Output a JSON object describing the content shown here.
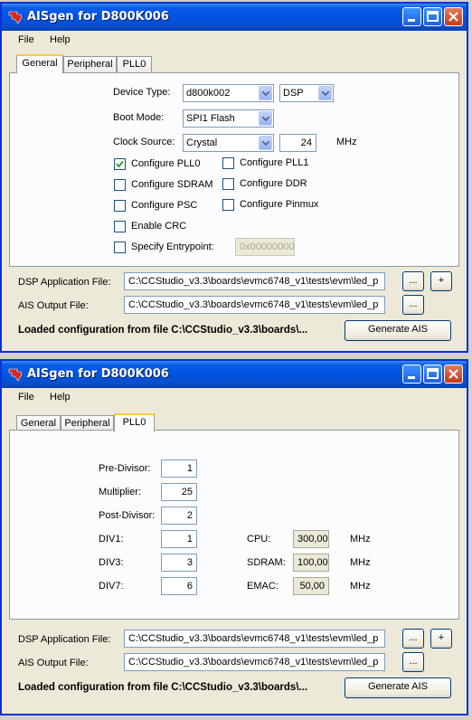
{
  "windows": [
    {
      "title": "AISgen for D800K006",
      "menu": [
        "File",
        "Help"
      ],
      "tabs": [
        "General",
        "Peripheral",
        "PLL0"
      ],
      "active_tab": "General",
      "general": {
        "device_type_label": "Device Type:",
        "device_type_value": "d800k002",
        "device_core_value": "DSP",
        "boot_mode_label": "Boot Mode:",
        "boot_mode_value": "SPI1 Flash",
        "clock_source_label": "Clock Source:",
        "clock_source_value": "Crystal",
        "clock_freq_value": "24",
        "clock_unit": "MHz",
        "checkboxes": [
          {
            "label": "Configure PLL0",
            "checked": true
          },
          {
            "label": "Configure PLL1",
            "checked": false
          },
          {
            "label": "Configure SDRAM",
            "checked": false
          },
          {
            "label": "Configure DDR",
            "checked": false
          },
          {
            "label": "Configure PSC",
            "checked": false
          },
          {
            "label": "Configure Pinmux",
            "checked": false
          },
          {
            "label": "Enable CRC",
            "checked": false
          },
          {
            "label": "Specify Entrypoint:",
            "checked": false
          }
        ],
        "entrypoint_value": "0x00000000"
      },
      "dsp_app_label": "DSP Application File:",
      "dsp_app_value": "C:\\CCStudio_v3.3\\boards\\evmc6748_v1\\tests\\evm\\led_p",
      "ais_out_label": "AIS Output File:",
      "ais_out_value": "C:\\CCStudio_v3.3\\boards\\evmc6748_v1\\tests\\evm\\led_p",
      "browse_label": "...",
      "add_label": "+",
      "status": "Loaded configuration from file C:\\CCStudio_v3.3\\boards\\...",
      "generate_label": "Generate AIS"
    },
    {
      "title": "AISgen for D800K006",
      "menu": [
        "File",
        "Help"
      ],
      "tabs": [
        "General",
        "Peripheral",
        "PLL0"
      ],
      "active_tab": "PLL0",
      "pll": {
        "pre_divisor_label": "Pre-Divisor:",
        "pre_divisor_value": "1",
        "multiplier_label": "Multiplier:",
        "multiplier_value": "25",
        "post_divisor_label": "Post-Divisor:",
        "post_divisor_value": "2",
        "div1_label": "DIV1:",
        "div1_value": "1",
        "div3_label": "DIV3:",
        "div3_value": "3",
        "div7_label": "DIV7:",
        "div7_value": "6",
        "cpu_label": "CPU:",
        "cpu_value": "300,00",
        "sdram_label": "SDRAM:",
        "sdram_value": "100,00",
        "emac_label": "EMAC:",
        "emac_value": "50,00",
        "unit": "MHz"
      },
      "dsp_app_label": "DSP Application File:",
      "dsp_app_value": "C:\\CCStudio_v3.3\\boards\\evmc6748_v1\\tests\\evm\\led_p",
      "ais_out_label": "AIS Output File:",
      "ais_out_value": "C:\\CCStudio_v3.3\\boards\\evmc6748_v1\\tests\\evm\\led_p",
      "browse_label": "...",
      "add_label": "+",
      "status": "Loaded configuration from file C:\\CCStudio_v3.3\\boards\\...",
      "generate_label": "Generate AIS"
    }
  ]
}
